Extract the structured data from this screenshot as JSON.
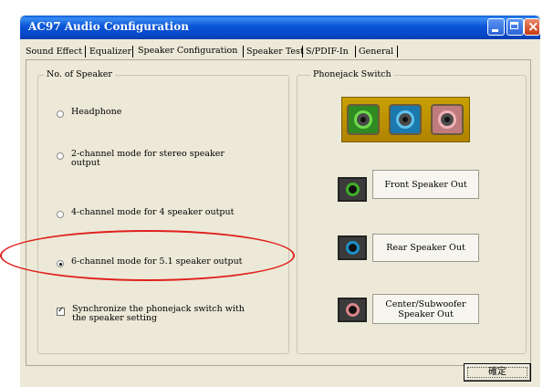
{
  "window": {
    "title": "AC97 Audio Configuration",
    "titlebar_color": "#0b55d6"
  },
  "tabs": [
    {
      "label": "Sound Effect",
      "active": false
    },
    {
      "label": "Equalizer",
      "active": false
    },
    {
      "label": "Speaker Configuration",
      "active": true
    },
    {
      "label": "Speaker Test",
      "active": false
    },
    {
      "label": "S/PDIF-In",
      "active": false
    },
    {
      "label": "General",
      "active": false
    }
  ],
  "speaker_group": {
    "legend": "No. of Speaker",
    "options": [
      {
        "label": "Headphone",
        "checked": false
      },
      {
        "label_line1": "2-channel mode for stereo speaker",
        "label_line2": "output",
        "checked": false
      },
      {
        "label": "4-channel mode for 4 speaker output",
        "checked": false
      },
      {
        "label": "6-channel mode for 5.1 speaker output",
        "checked": true
      }
    ],
    "sync_checkbox": {
      "label_line1": "Synchronize the phonejack switch with",
      "label_line2": "the speaker setting",
      "checked": true
    }
  },
  "phonejack_group": {
    "legend": "Phonejack Switch",
    "jacks": [
      {
        "name": "green-jack-icon",
        "color": "#3fae2a"
      },
      {
        "name": "blue-jack-icon",
        "color": "#1d8fc7"
      },
      {
        "name": "pink-jack-icon",
        "color": "#d9868a"
      }
    ],
    "outputs": [
      {
        "label_line1": "Front Speaker Out",
        "label_line2": "",
        "color": "#3fae2a"
      },
      {
        "label_line1": "Rear Speaker Out",
        "label_line2": "",
        "color": "#1d8fc7"
      },
      {
        "label_line1": "Center/Subwoofer",
        "label_line2": "Speaker Out",
        "color": "#d9868a"
      }
    ]
  },
  "ok_button": {
    "label": "確定"
  },
  "annotation": {
    "color": "#e0211d"
  }
}
